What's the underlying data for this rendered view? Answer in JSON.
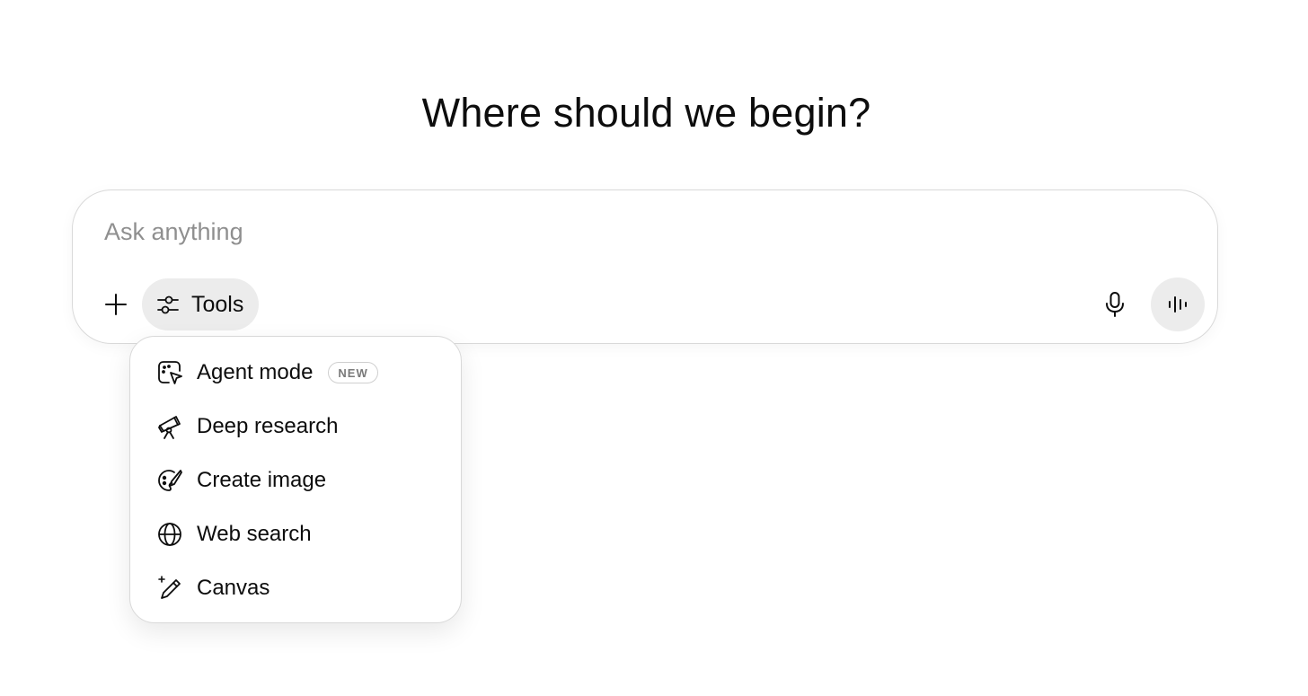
{
  "heading": "Where should we begin?",
  "composer": {
    "placeholder": "Ask anything",
    "value": "",
    "plus_icon": "plus-icon",
    "tools_label": "Tools",
    "tools_icon": "sliders-icon",
    "mic_icon": "microphone-icon",
    "voice_icon": "voice-waveform-icon"
  },
  "tools_menu": {
    "items": [
      {
        "label": "Agent mode",
        "icon": "agent-cursor-icon",
        "badge": "NEW"
      },
      {
        "label": "Deep research",
        "icon": "telescope-icon"
      },
      {
        "label": "Create image",
        "icon": "palette-brush-icon"
      },
      {
        "label": "Web search",
        "icon": "globe-icon"
      },
      {
        "label": "Canvas",
        "icon": "pencil-sparkle-icon"
      }
    ]
  },
  "colors": {
    "text": "#0d0d0d",
    "placeholder": "#8f8f8f",
    "pill_background": "#ececec",
    "border": "#d9d9d9",
    "badge_text": "#7a7a7a"
  }
}
